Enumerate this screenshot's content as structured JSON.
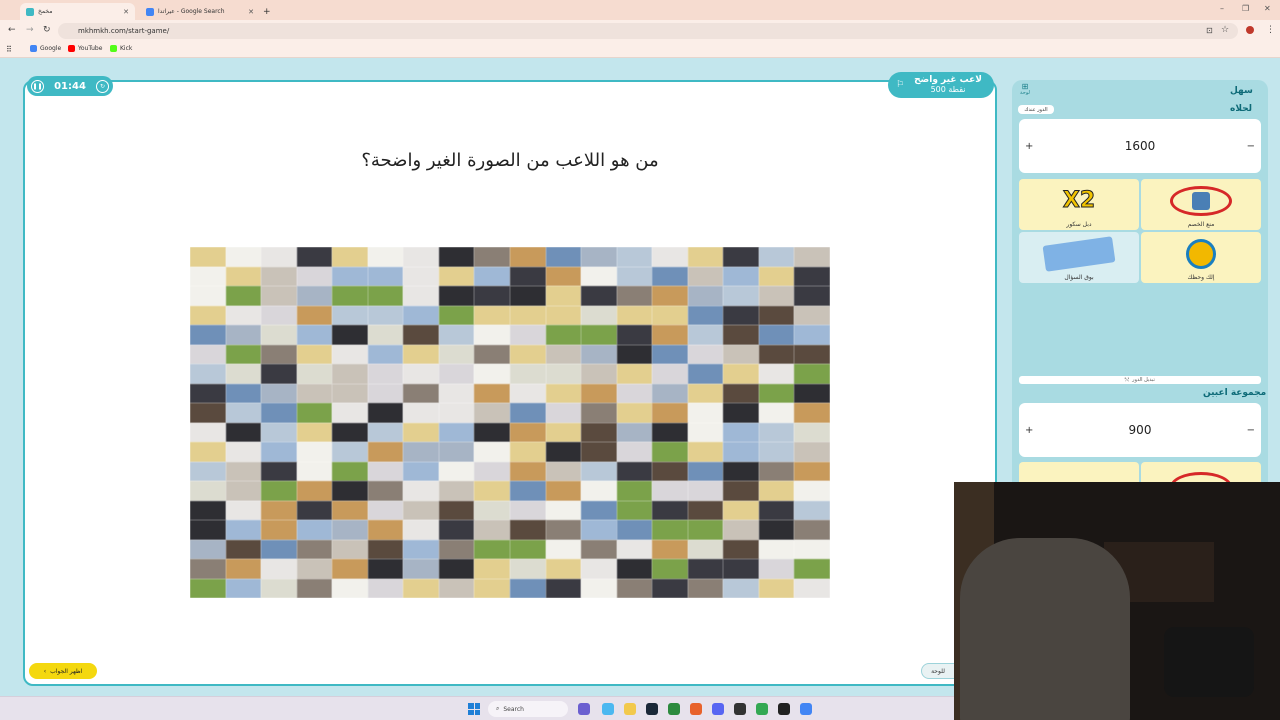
{
  "browser": {
    "tabs": [
      {
        "label": "مخمخ",
        "active": true
      },
      {
        "label": "عيراتدا - Google Search",
        "active": false
      }
    ],
    "new_tab": "+",
    "url": "mkhmkh.com/start-game/",
    "bookmarks": [
      {
        "label": "Google",
        "color": "#4285f4"
      },
      {
        "label": "YouTube",
        "color": "#ff0000"
      },
      {
        "label": "Kick",
        "color": "#53fc18"
      }
    ],
    "window_controls": [
      "–",
      "❐",
      "✕"
    ]
  },
  "game": {
    "timer": "01:44",
    "pause_icon": "pause-icon",
    "reset_icon": "reset-icon",
    "category": {
      "title": "لاعب غير واضح",
      "points": "500 نقطة",
      "flag_icon": "flag-icon"
    },
    "question": "من هو اللاعب من الصورة الغير واضحة؟",
    "show_answer_label": "اظهر الجواب",
    "board_label": "للوحة"
  },
  "sidebar": {
    "board_label": "لوحة",
    "level": "سهل",
    "turn_badge": "الدور عندك",
    "switch_turn_label": "تبديل الدور",
    "teams": [
      {
        "name": "لحلاه",
        "score": "1600",
        "plus": "+",
        "minus": "−",
        "tools": [
          {
            "label": "X2",
            "caption": "دبل سكور"
          },
          {
            "label": "🚫",
            "caption": "منع الخصم"
          },
          {
            "label": "☎",
            "caption": "بوق السؤال"
          },
          {
            "label": "◉",
            "caption": "إلك وحظك"
          }
        ]
      },
      {
        "name": "مجموعة اعبين",
        "score": "900",
        "plus": "+",
        "minus": "−"
      }
    ]
  },
  "taskbar": {
    "search_placeholder": "Search"
  },
  "colors": {
    "accent": "#3fb9c4",
    "page_bg": "#c3e6ed",
    "answer_btn": "#f4d80f",
    "tab_strip": "#f6dcd0"
  }
}
